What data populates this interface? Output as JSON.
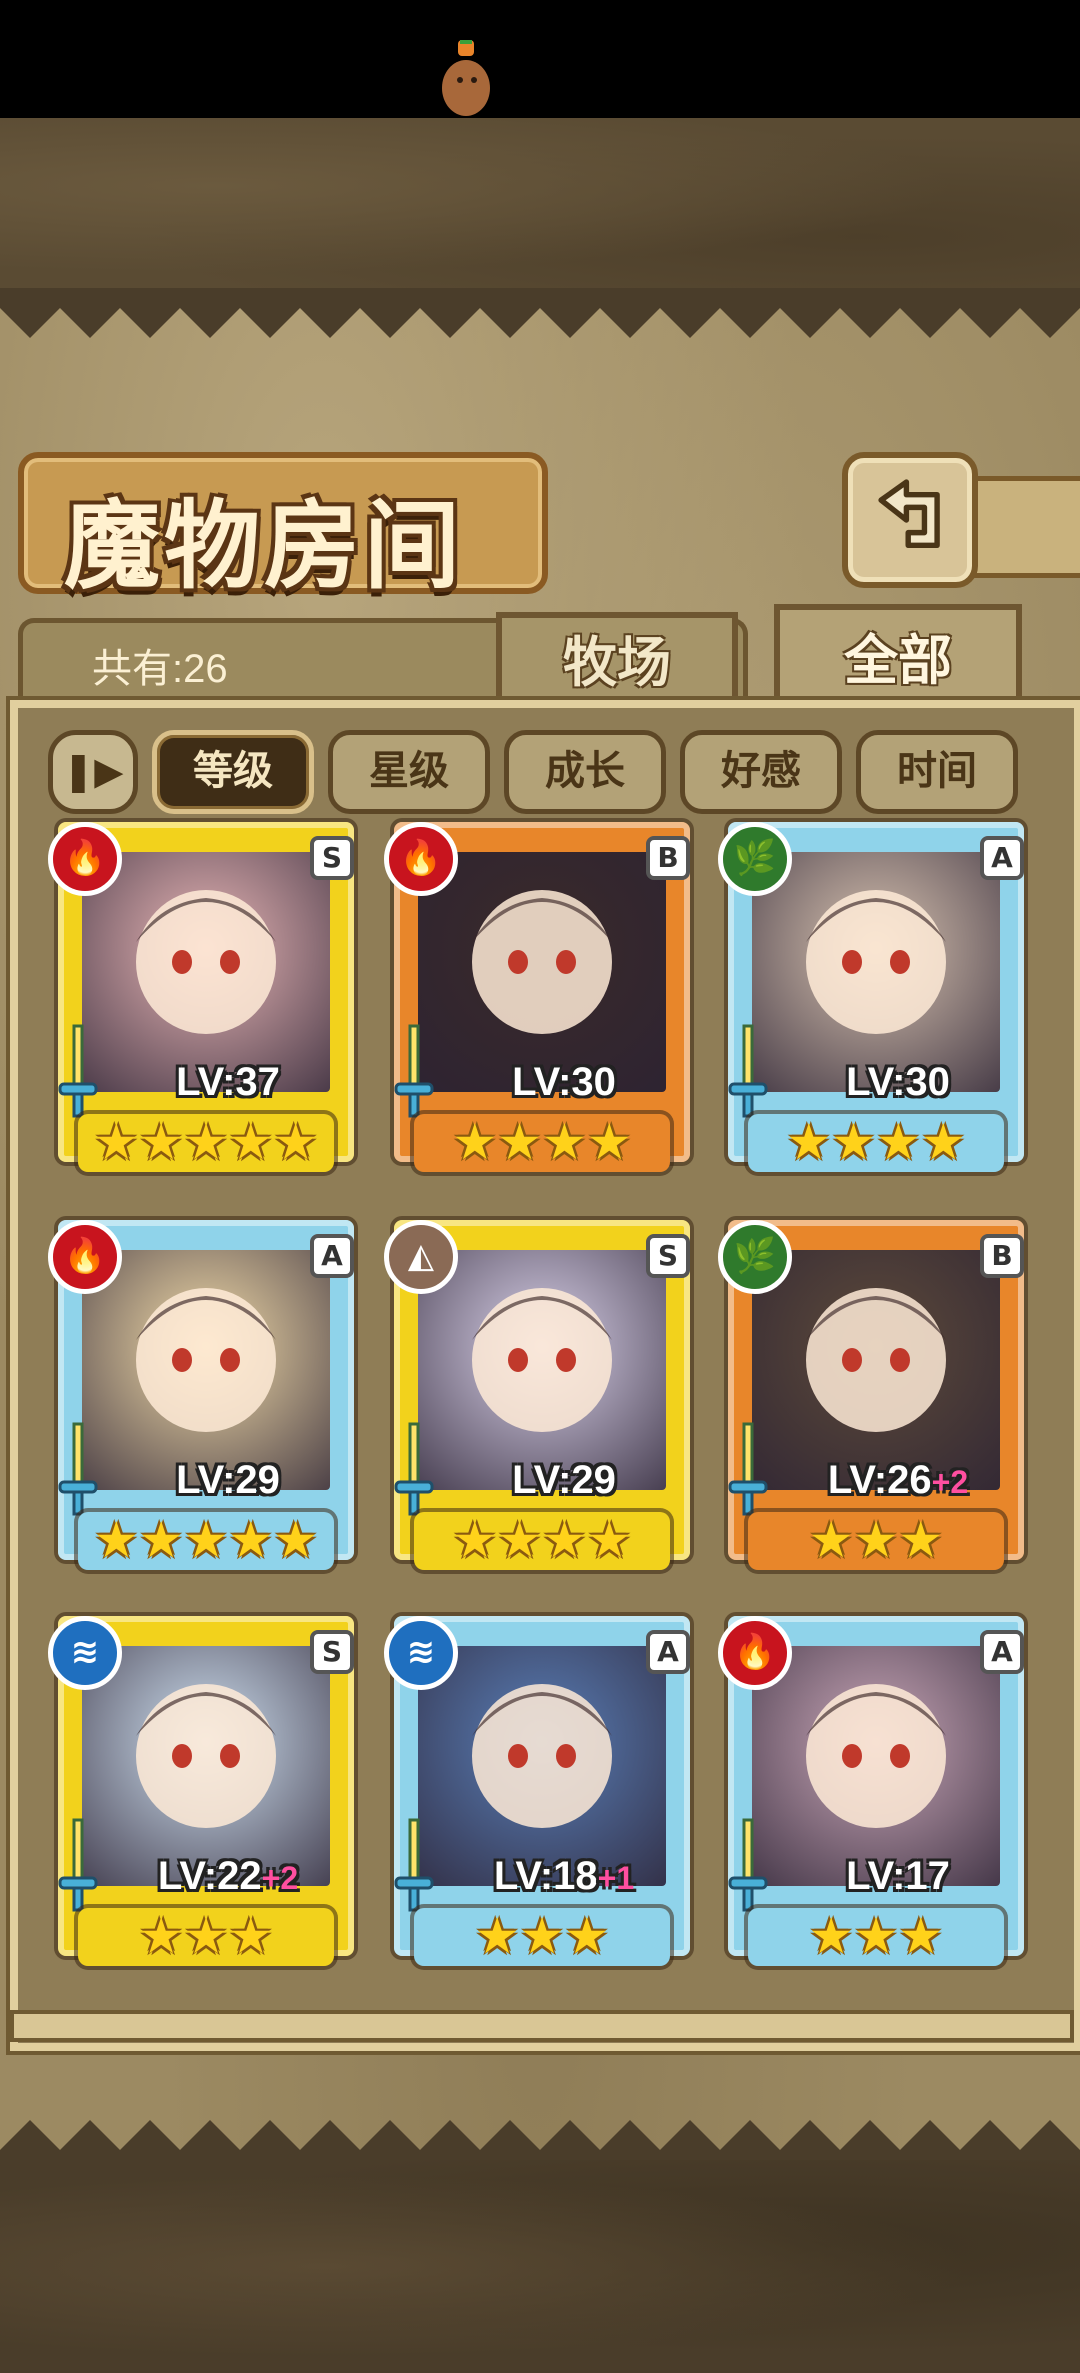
{
  "screen": {
    "title": "魔物房间",
    "count_label": "共有:26",
    "tabs": [
      {
        "label": "牧场",
        "active": false
      },
      {
        "label": "全部",
        "active": true
      }
    ],
    "sort_toggle_icon": "pause-sort-icon",
    "sort_buttons": [
      {
        "label": "等级",
        "active": true
      },
      {
        "label": "星级",
        "active": false
      },
      {
        "label": "成长",
        "active": false
      },
      {
        "label": "好感",
        "active": false
      },
      {
        "label": "时间",
        "active": false
      }
    ],
    "back_icon": "return-arrow-icon"
  },
  "monsters": [
    {
      "level": "LV:37",
      "bonus": "",
      "rank": "S",
      "stars": 5,
      "element": "fire",
      "frame": "gold"
    },
    {
      "level": "LV:30",
      "bonus": "",
      "rank": "B",
      "stars": 4,
      "element": "fire",
      "frame": "orange"
    },
    {
      "level": "LV:30",
      "bonus": "",
      "rank": "A",
      "stars": 4,
      "element": "wood",
      "frame": "blue"
    },
    {
      "level": "LV:29",
      "bonus": "",
      "rank": "A",
      "stars": 5,
      "element": "fire",
      "frame": "blue"
    },
    {
      "level": "LV:29",
      "bonus": "",
      "rank": "S",
      "stars": 4,
      "element": "earth",
      "frame": "gold"
    },
    {
      "level": "LV:26",
      "bonus": "+2",
      "rank": "B",
      "stars": 3,
      "element": "wood",
      "frame": "orange"
    },
    {
      "level": "LV:22",
      "bonus": "+2",
      "rank": "S",
      "stars": 3,
      "element": "water",
      "frame": "gold"
    },
    {
      "level": "LV:18",
      "bonus": "+1",
      "rank": "A",
      "stars": 3,
      "element": "water",
      "frame": "blue"
    },
    {
      "level": "LV:17",
      "bonus": "",
      "rank": "A",
      "stars": 3,
      "element": "fire",
      "frame": "blue"
    }
  ],
  "colors": {
    "frame_gold": "#f2d21c",
    "frame_orange": "#e8862a",
    "frame_blue": "#8fd3ea",
    "element_fire": "#c8141e",
    "element_wood": "#2f7a2c",
    "element_water": "#1f6fbf",
    "element_earth": "#8a6a55",
    "star": "#ffd21a",
    "level_bonus": "#ff4fa0"
  }
}
